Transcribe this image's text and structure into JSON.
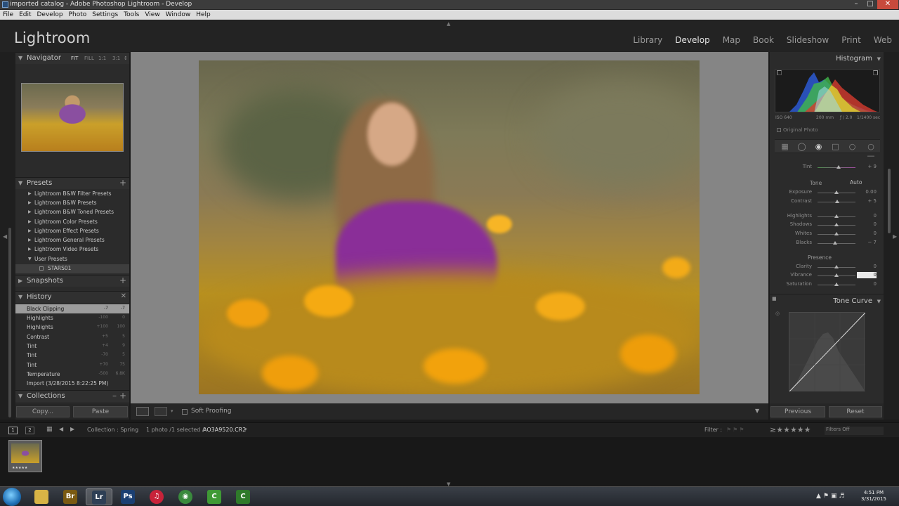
{
  "window": {
    "title": "imported catalog - Adobe Photoshop Lightroom - Develop"
  },
  "menu": [
    "File",
    "Edit",
    "Develop",
    "Photo",
    "Settings",
    "Tools",
    "View",
    "Window",
    "Help"
  ],
  "app": {
    "logo": "Lightroom"
  },
  "modules": [
    {
      "label": "Library",
      "active": false
    },
    {
      "label": "Develop",
      "active": true
    },
    {
      "label": "Map",
      "active": false
    },
    {
      "label": "Book",
      "active": false
    },
    {
      "label": "Slideshow",
      "active": false
    },
    {
      "label": "Print",
      "active": false
    },
    {
      "label": "Web",
      "active": false
    }
  ],
  "left": {
    "navigator": {
      "title": "Navigator",
      "opts": [
        "FIT",
        "FILL",
        "1:1",
        "3:1"
      ]
    },
    "presets": {
      "title": "Presets",
      "items": [
        "Lightroom B&W Filter Presets",
        "Lightroom B&W Presets",
        "Lightroom B&W Toned Presets",
        "Lightroom Color Presets",
        "Lightroom Effect Presets",
        "Lightroom General Presets",
        "Lightroom Video Presets",
        "User Presets"
      ],
      "sub": "STARS01"
    },
    "snapshots": {
      "title": "Snapshots"
    },
    "history": {
      "title": "History",
      "rows": [
        {
          "name": "Black Clipping",
          "v1": "-7",
          "v2": "-7"
        },
        {
          "name": "Highlights",
          "v1": "-100",
          "v2": "0"
        },
        {
          "name": "Highlights",
          "v1": "+100",
          "v2": "100"
        },
        {
          "name": "Contrast",
          "v1": "+5",
          "v2": "5"
        },
        {
          "name": "Tint",
          "v1": "+4",
          "v2": "9"
        },
        {
          "name": "Tint",
          "v1": "-70",
          "v2": "5"
        },
        {
          "name": "Tint",
          "v1": "+70",
          "v2": "75"
        },
        {
          "name": "Temperature",
          "v1": "-500",
          "v2": "6.8K"
        },
        {
          "name": "Import (3/28/2015 8:22:25 PM)",
          "v1": "",
          "v2": ""
        }
      ]
    },
    "collections": {
      "title": "Collections"
    },
    "copy_label": "Copy...",
    "paste_label": "Paste"
  },
  "center": {
    "soft_proofing": "Soft Proofing"
  },
  "right": {
    "histogram": {
      "title": "Histogram",
      "info": [
        "ISO 640",
        "200 mm",
        "ƒ / 2.0",
        "1/1400 sec"
      ],
      "original_photo": "Original Photo"
    },
    "basic": {
      "tint_label": "Tint",
      "tint_value": "+ 9",
      "tint": 0.55,
      "tone_label": "Tone",
      "auto_label": "Auto",
      "tone": [
        {
          "name": "Exposure",
          "value": "0.00",
          "level": 0.5
        },
        {
          "name": "Contrast",
          "value": "+ 5",
          "level": 0.52
        },
        {
          "name": "Highlights",
          "value": "0",
          "level": 0.5
        },
        {
          "name": "Shadows",
          "value": "0",
          "level": 0.5
        },
        {
          "name": "Whites",
          "value": "0",
          "level": 0.5
        },
        {
          "name": "Blacks",
          "value": "− 7",
          "level": 0.47
        }
      ],
      "presence_label": "Presence",
      "presence": [
        {
          "name": "Clarity",
          "value": "0",
          "level": 0.5
        },
        {
          "name": "Vibrance",
          "value": "0",
          "level": 0.5,
          "editing": true
        },
        {
          "name": "Saturation",
          "value": "0",
          "level": 0.5
        }
      ]
    },
    "tone_curve": {
      "title": "Tone Curve"
    },
    "previous_label": "Previous",
    "reset_label": "Reset"
  },
  "filmbar": {
    "collection": "Collection : Spring",
    "selection": "1 photo /1 selected /",
    "filename": "AO3A9520.CR2",
    "filter_label": "Filter :",
    "filters_off": "Filters Off"
  },
  "taskbar": {
    "apps": [
      {
        "name": "Explorer",
        "glyph": "",
        "color": "#d8b446"
      },
      {
        "name": "Bridge",
        "glyph": "Br",
        "color": "#7a5a12"
      },
      {
        "name": "Lightroom",
        "glyph": "Lr",
        "color": "#2e3f55",
        "active": true
      },
      {
        "name": "Photoshop",
        "glyph": "Ps",
        "color": "#1b3f72"
      },
      {
        "name": "iTunes",
        "glyph": "♫",
        "color": "#c8233a"
      },
      {
        "name": "Chrome",
        "glyph": "◉",
        "color": "#3a8a3d"
      },
      {
        "name": "Camtasia",
        "glyph": "C",
        "color": "#3f9a35"
      },
      {
        "name": "Camtasia2",
        "glyph": "C",
        "color": "#2f7a2a"
      }
    ],
    "time": "4:51 PM",
    "date": "3/31/2015"
  }
}
